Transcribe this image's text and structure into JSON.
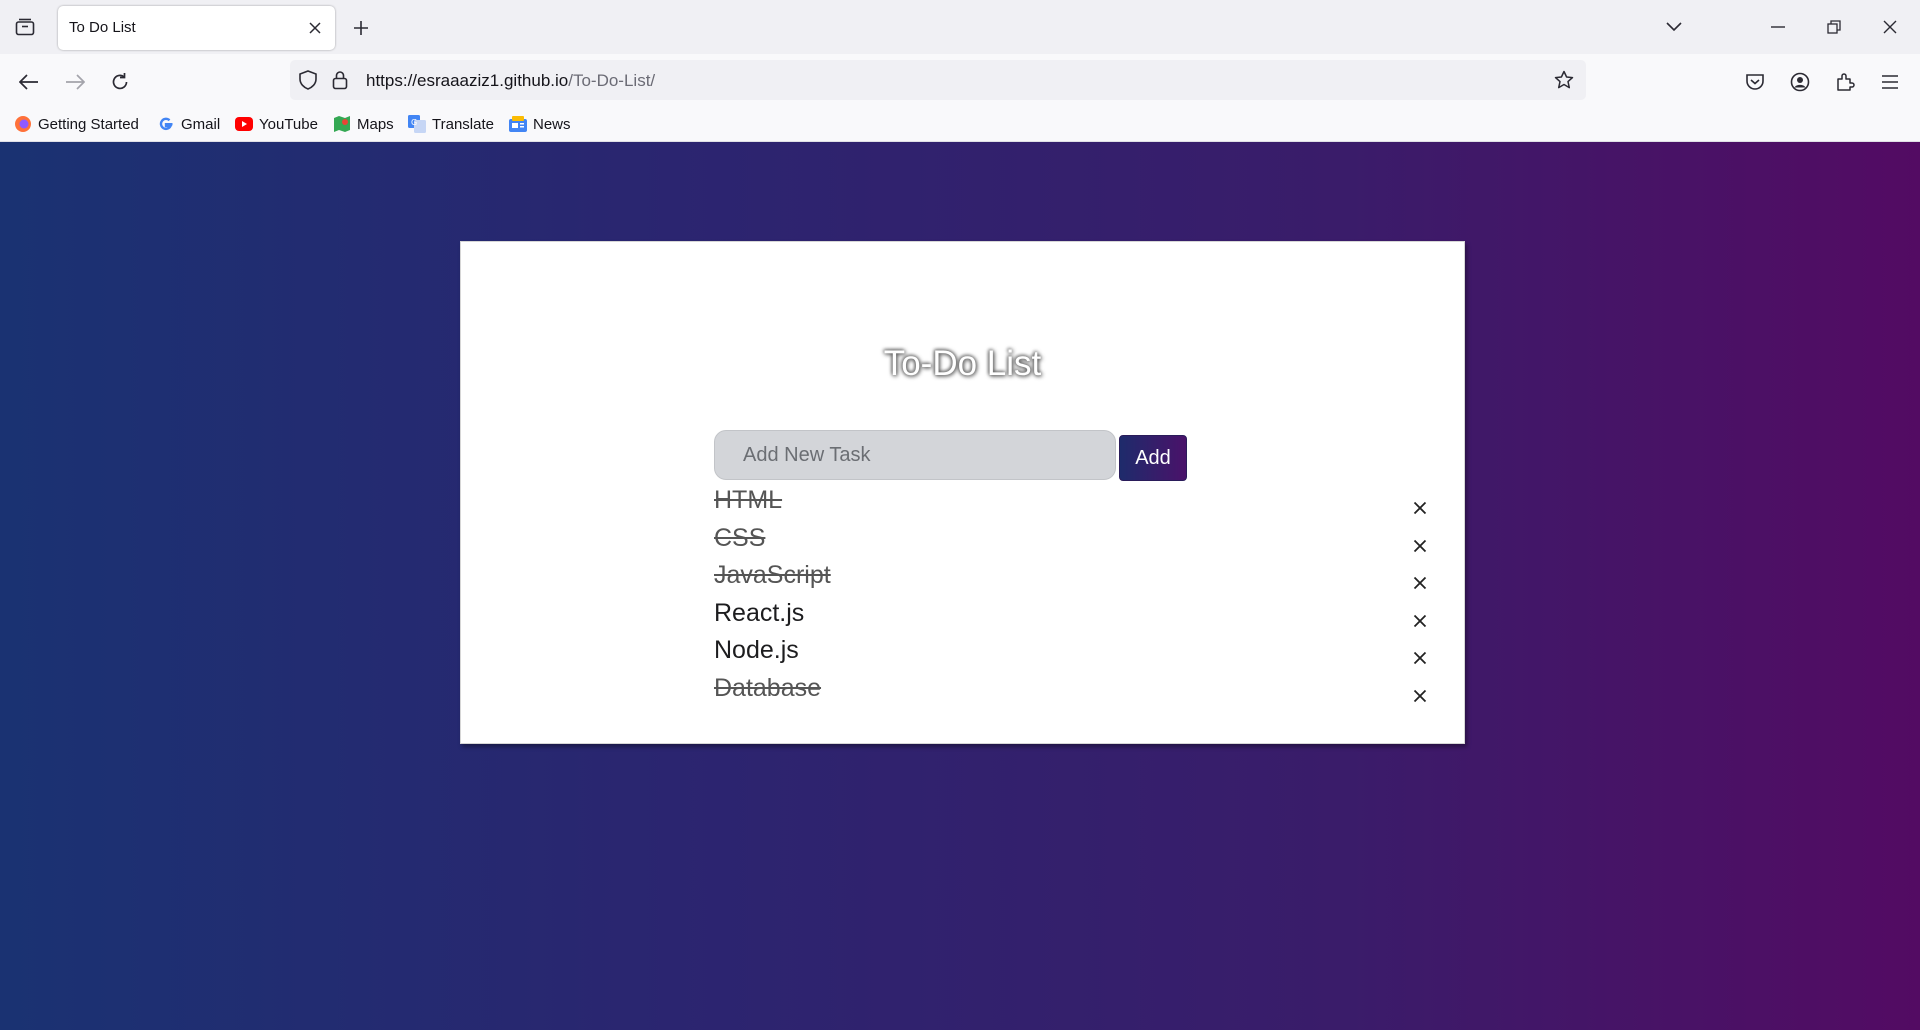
{
  "browser": {
    "tab_title": "To Do List",
    "url_host": "https://esraaaziz1.github.io",
    "url_path": "/To-Do-List/",
    "bookmarks": [
      {
        "label": "Getting Started",
        "icon": "firefox-icon"
      },
      {
        "label": "Gmail",
        "icon": "google-icon"
      },
      {
        "label": "YouTube",
        "icon": "youtube-icon"
      },
      {
        "label": "Maps",
        "icon": "maps-icon"
      },
      {
        "label": "Translate",
        "icon": "translate-icon"
      },
      {
        "label": "News",
        "icon": "news-icon"
      }
    ]
  },
  "app": {
    "title": "To-Do List",
    "input_placeholder": "Add New Task",
    "input_value": "",
    "add_label": "Add",
    "delete_glyph": "×",
    "tasks": [
      {
        "text": "HTML",
        "done": true
      },
      {
        "text": "CSS",
        "done": true
      },
      {
        "text": "JavaScript",
        "done": true
      },
      {
        "text": "React.js",
        "done": false
      },
      {
        "text": "Node.js",
        "done": false
      },
      {
        "text": "Database",
        "done": true
      }
    ]
  },
  "colors": {
    "bg_gradient_start": "#1a3272",
    "bg_gradient_end": "#530b63",
    "add_button": "#2f1a6a"
  }
}
